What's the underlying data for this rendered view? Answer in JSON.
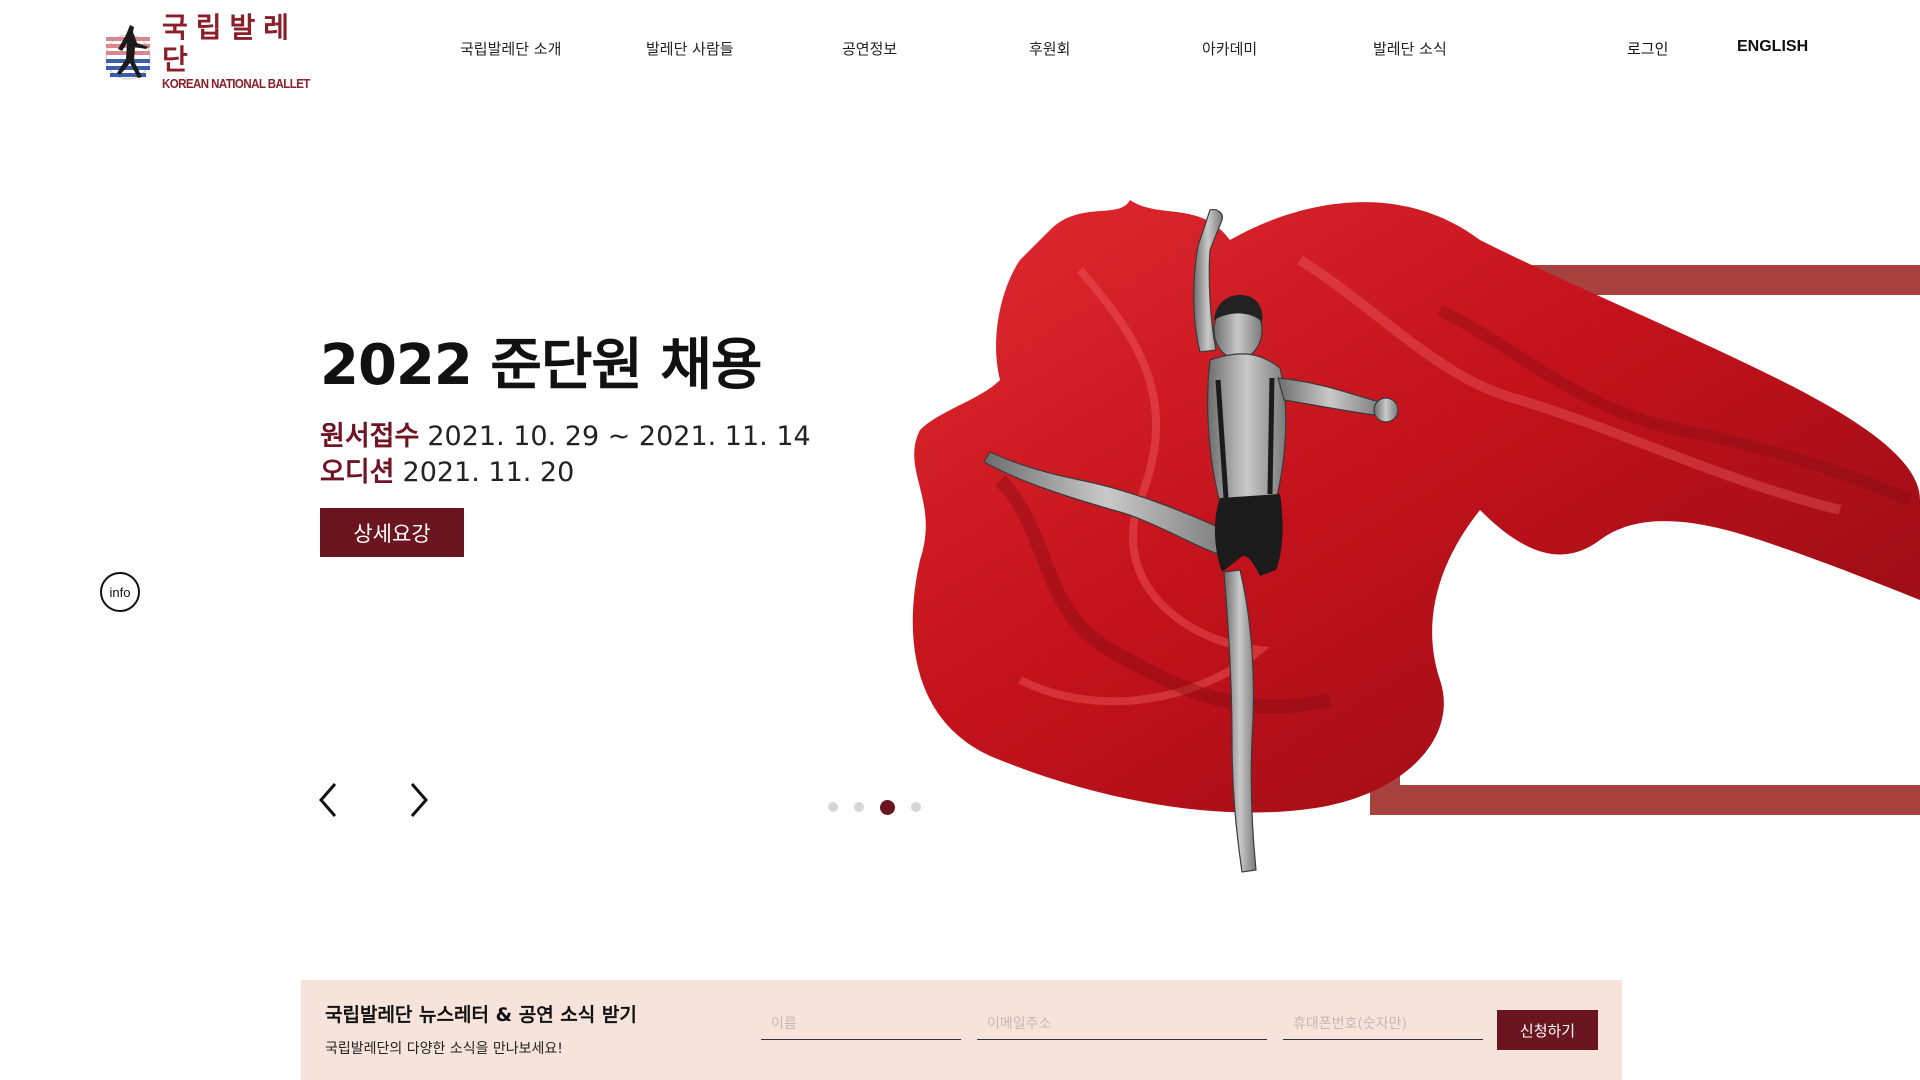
{
  "logo": {
    "ko": "국립발레단",
    "en": "KOREAN NATIONAL BALLET"
  },
  "nav": {
    "items": [
      {
        "label": "국립발레단 소개"
      },
      {
        "label": "발레단 사람들"
      },
      {
        "label": "공연정보"
      },
      {
        "label": "후원회"
      },
      {
        "label": "아카데미"
      },
      {
        "label": "발레단 소식"
      }
    ],
    "login": "로그인",
    "english": "ENGLISH"
  },
  "hero": {
    "title": "2022 준단원 채용",
    "application_label": "원서접수",
    "application_dates": "2021. 10. 29 ~ 2021. 11. 14",
    "audition_label": "오디션",
    "audition_date": "2021. 11. 20",
    "detail_button": "상세요강",
    "info_button": "info",
    "slides_total": 4,
    "active_slide": 3
  },
  "colors": {
    "brand": "#6b1521",
    "frame": "#a8423f",
    "newsletter_bg": "#f6e4dc",
    "fabric": "#c8151f"
  },
  "icons": {
    "prev": "chevron-left-icon",
    "next": "chevron-right-icon"
  },
  "newsletter": {
    "title": "국립발레단 뉴스레터 & 공연 소식 받기",
    "subtitle": "국립발레단의 다양한 소식을 만나보세요!",
    "name_placeholder": "이름",
    "email_placeholder": "이메일주소",
    "phone_placeholder": "휴대폰번호(숫자만)",
    "submit": "신청하기"
  }
}
